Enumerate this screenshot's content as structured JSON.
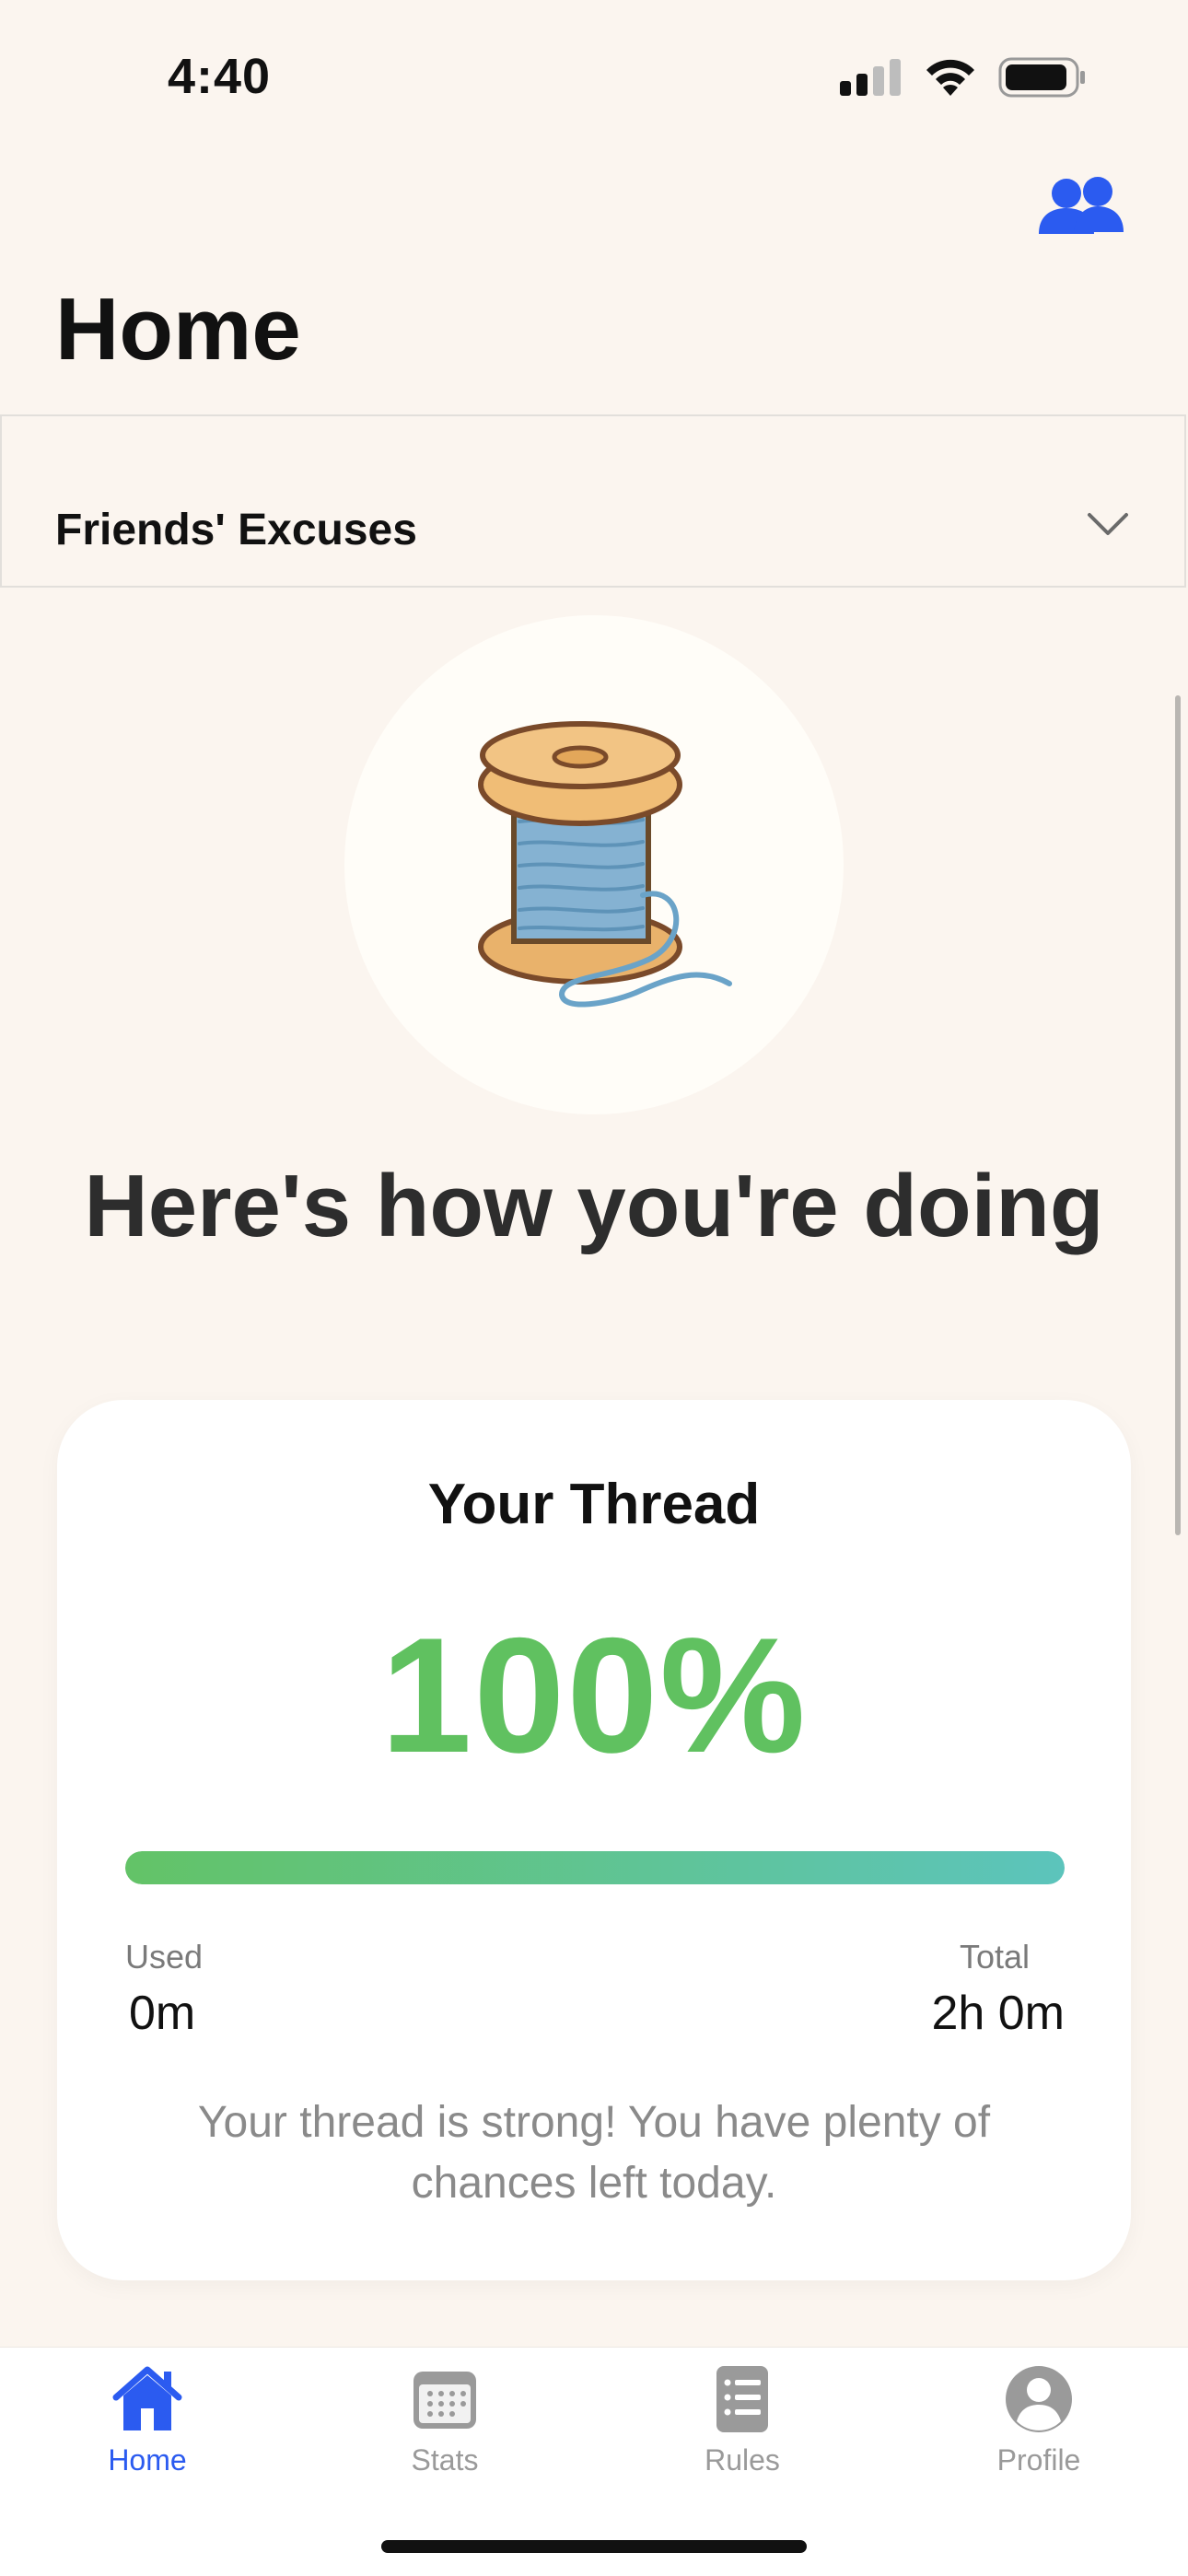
{
  "status_bar": {
    "time": "4:40",
    "icons": [
      "cellular-signal-icon",
      "wifi-icon",
      "battery-icon"
    ]
  },
  "header": {
    "title": "Home",
    "friends_icon": "friends-icon"
  },
  "excuses": {
    "label": "Friends' Excuses",
    "chevron_icon": "chevron-down-icon"
  },
  "hero": {
    "illustration": "thread-spool-icon",
    "headline": "Here's how you're doing"
  },
  "thread_card": {
    "title": "Your Thread",
    "percent": "100%",
    "progress_fraction": 1.0,
    "used_label": "Used",
    "used_value": "0m",
    "total_label": "Total",
    "total_value": "2h 0m",
    "message": "Your thread is strong! You have plenty of chances left today."
  },
  "tab_bar": {
    "tabs": [
      {
        "label": "Home",
        "icon": "home-icon",
        "active": true
      },
      {
        "label": "Stats",
        "icon": "calendar-icon",
        "active": false
      },
      {
        "label": "Rules",
        "icon": "list-icon",
        "active": false
      },
      {
        "label": "Profile",
        "icon": "person-circle-icon",
        "active": false
      }
    ]
  },
  "colors": {
    "background": "#fbf5ef",
    "accent_blue": "#2b5bf0",
    "success_green": "#60c160",
    "progress_end_teal": "#5cc4bc",
    "inactive_gray": "#9a9a9a"
  }
}
